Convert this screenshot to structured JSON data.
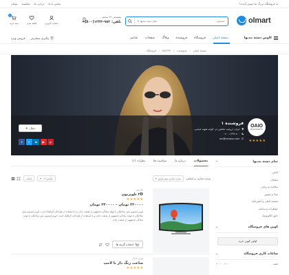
{
  "topbar": {
    "promo": "به فروشگاه بزرگ ما خوش آمدید!",
    "links": [
      "تماس با ما",
      "درباره ما",
      "مقایسه",
      "تومان"
    ]
  },
  "header": {
    "logo_text": "olmart",
    "search": {
      "placeholder": "جستجو...",
      "category": "تمام دسته بندیها"
    },
    "support": {
      "label": "پشتیبانی ۲۴ ساعته",
      "phone": "تلفن: ۹۸۲-۱۲۳۳(۸۰۰)+"
    },
    "icons": [
      {
        "label": "سبد خرید",
        "badge": "0"
      },
      {
        "label": "علاقه مندی"
      },
      {
        "label": "حساب کاربری"
      }
    ]
  },
  "nav": {
    "categories_label": "کاوش دسته بندیها",
    "menu": [
      "صفحه اصلی",
      "فروشگاه",
      "فروشنده",
      "وبلاگ",
      "صفحات",
      "عناصر"
    ],
    "extra": [
      "پیگیری سفارش",
      "فروش ویژه"
    ]
  },
  "breadcrumb": [
    "صفحه اصلی",
    "فروشنده",
    "WCFM",
    "فروشگاه"
  ],
  "vendor": {
    "logo_text": "OAIO",
    "logo_sub": "PHOTOGRAPHY",
    "name": "فروشنده ۱",
    "location": "ایران، ارومیه، شاهین دژ، کوچه شهید عباسی",
    "phone": "۰۸۰۰-۱۲۳۳-۸۰۰",
    "email": "wc@vendor.com",
    "follow_label": "دنبال",
    "rating": 5,
    "socials": [
      {
        "name": "facebook",
        "glyph": "f",
        "color": "#3b5998"
      },
      {
        "name": "twitter",
        "glyph": "t",
        "color": "#1da1f2"
      },
      {
        "name": "linkedin",
        "glyph": "in",
        "color": "#0077b5"
      },
      {
        "name": "youtube",
        "glyph": "▶",
        "color": "#e52d27"
      },
      {
        "name": "pinterest",
        "glyph": "p",
        "color": "#cb2027"
      }
    ]
  },
  "sidebar": {
    "categories_title": "تمام دسته بندیها",
    "categories": [
      "لباس",
      "مبلمان",
      "سلامت و زیبایی",
      "صدا و تصویر",
      "صفحه اصلی و آشپزخانه",
      "جواهرات و ساعت",
      "دکور الکترونیک"
    ],
    "coupon_title": "کوپن های فروشگاه",
    "coupon_button": "اولین کوپن خرید",
    "hours_title": "ساعات کاری فروشگاه",
    "hours": [
      {
        "day": "شنبه",
        "time": "۹:۰۰ - ۲۰:۰۰"
      }
    ]
  },
  "tabs": [
    "محصولات",
    "درباره ما",
    "سیاست ها",
    "نظرات (۱)"
  ],
  "filter": {
    "label": "مرتب سازی بر اساس:",
    "chip": "مرتب سازی پیش فرض"
  },
  "sort": {
    "select": "نمایش ۱۲",
    "order": "ترتیب"
  },
  "products": [
    {
      "category": "تلویزیون",
      "name": "۳D تلویزیون",
      "rating": 5,
      "price": "۲۲۰۰۰۰ تومان – ۲۳۰۰۰۰ تومان",
      "description": "لورم ایپسوم متن ساختگی با تولید سادگی نامفهوم از صنعت چاپ و با استفاده از طراحان گرافیک است. لورم ایپسوم متن ساختگی با تولید سادگی نامفهوم از صنعت چاپ و با استفاده از طراحان گرافیک است. لورم ایپسوم متن ساختگی با تولید سادگی نامفهوم از صنعت چاپ",
      "button": "انتخاب گزینه ها"
    },
    {
      "category": "لوازم خانگی",
      "name": "ساعت زنگ دار با لامپ",
      "rating": 5
    }
  ],
  "colors": {
    "accent": "#1e8ae0",
    "star": "#f5a623"
  }
}
